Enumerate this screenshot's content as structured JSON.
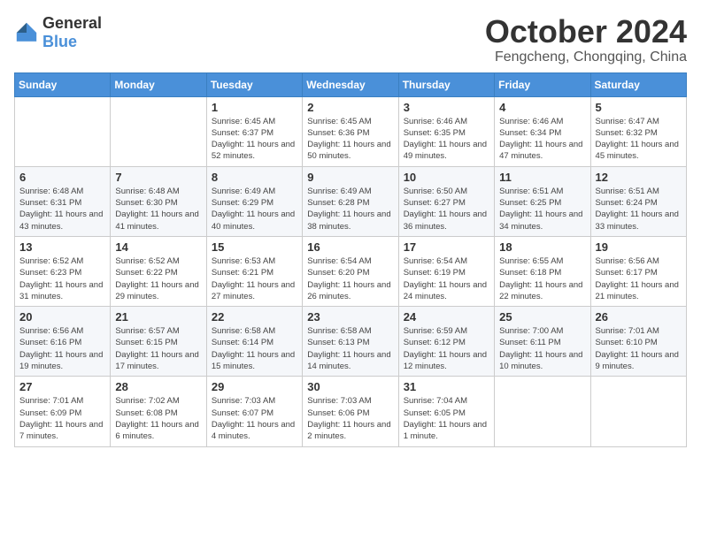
{
  "logo": {
    "text_general": "General",
    "text_blue": "Blue"
  },
  "header": {
    "month": "October 2024",
    "location": "Fengcheng, Chongqing, China"
  },
  "weekdays": [
    "Sunday",
    "Monday",
    "Tuesday",
    "Wednesday",
    "Thursday",
    "Friday",
    "Saturday"
  ],
  "weeks": [
    [
      {
        "day": "",
        "info": ""
      },
      {
        "day": "",
        "info": ""
      },
      {
        "day": "1",
        "info": "Sunrise: 6:45 AM\nSunset: 6:37 PM\nDaylight: 11 hours and 52 minutes."
      },
      {
        "day": "2",
        "info": "Sunrise: 6:45 AM\nSunset: 6:36 PM\nDaylight: 11 hours and 50 minutes."
      },
      {
        "day": "3",
        "info": "Sunrise: 6:46 AM\nSunset: 6:35 PM\nDaylight: 11 hours and 49 minutes."
      },
      {
        "day": "4",
        "info": "Sunrise: 6:46 AM\nSunset: 6:34 PM\nDaylight: 11 hours and 47 minutes."
      },
      {
        "day": "5",
        "info": "Sunrise: 6:47 AM\nSunset: 6:32 PM\nDaylight: 11 hours and 45 minutes."
      }
    ],
    [
      {
        "day": "6",
        "info": "Sunrise: 6:48 AM\nSunset: 6:31 PM\nDaylight: 11 hours and 43 minutes."
      },
      {
        "day": "7",
        "info": "Sunrise: 6:48 AM\nSunset: 6:30 PM\nDaylight: 11 hours and 41 minutes."
      },
      {
        "day": "8",
        "info": "Sunrise: 6:49 AM\nSunset: 6:29 PM\nDaylight: 11 hours and 40 minutes."
      },
      {
        "day": "9",
        "info": "Sunrise: 6:49 AM\nSunset: 6:28 PM\nDaylight: 11 hours and 38 minutes."
      },
      {
        "day": "10",
        "info": "Sunrise: 6:50 AM\nSunset: 6:27 PM\nDaylight: 11 hours and 36 minutes."
      },
      {
        "day": "11",
        "info": "Sunrise: 6:51 AM\nSunset: 6:25 PM\nDaylight: 11 hours and 34 minutes."
      },
      {
        "day": "12",
        "info": "Sunrise: 6:51 AM\nSunset: 6:24 PM\nDaylight: 11 hours and 33 minutes."
      }
    ],
    [
      {
        "day": "13",
        "info": "Sunrise: 6:52 AM\nSunset: 6:23 PM\nDaylight: 11 hours and 31 minutes."
      },
      {
        "day": "14",
        "info": "Sunrise: 6:52 AM\nSunset: 6:22 PM\nDaylight: 11 hours and 29 minutes."
      },
      {
        "day": "15",
        "info": "Sunrise: 6:53 AM\nSunset: 6:21 PM\nDaylight: 11 hours and 27 minutes."
      },
      {
        "day": "16",
        "info": "Sunrise: 6:54 AM\nSunset: 6:20 PM\nDaylight: 11 hours and 26 minutes."
      },
      {
        "day": "17",
        "info": "Sunrise: 6:54 AM\nSunset: 6:19 PM\nDaylight: 11 hours and 24 minutes."
      },
      {
        "day": "18",
        "info": "Sunrise: 6:55 AM\nSunset: 6:18 PM\nDaylight: 11 hours and 22 minutes."
      },
      {
        "day": "19",
        "info": "Sunrise: 6:56 AM\nSunset: 6:17 PM\nDaylight: 11 hours and 21 minutes."
      }
    ],
    [
      {
        "day": "20",
        "info": "Sunrise: 6:56 AM\nSunset: 6:16 PM\nDaylight: 11 hours and 19 minutes."
      },
      {
        "day": "21",
        "info": "Sunrise: 6:57 AM\nSunset: 6:15 PM\nDaylight: 11 hours and 17 minutes."
      },
      {
        "day": "22",
        "info": "Sunrise: 6:58 AM\nSunset: 6:14 PM\nDaylight: 11 hours and 15 minutes."
      },
      {
        "day": "23",
        "info": "Sunrise: 6:58 AM\nSunset: 6:13 PM\nDaylight: 11 hours and 14 minutes."
      },
      {
        "day": "24",
        "info": "Sunrise: 6:59 AM\nSunset: 6:12 PM\nDaylight: 11 hours and 12 minutes."
      },
      {
        "day": "25",
        "info": "Sunrise: 7:00 AM\nSunset: 6:11 PM\nDaylight: 11 hours and 10 minutes."
      },
      {
        "day": "26",
        "info": "Sunrise: 7:01 AM\nSunset: 6:10 PM\nDaylight: 11 hours and 9 minutes."
      }
    ],
    [
      {
        "day": "27",
        "info": "Sunrise: 7:01 AM\nSunset: 6:09 PM\nDaylight: 11 hours and 7 minutes."
      },
      {
        "day": "28",
        "info": "Sunrise: 7:02 AM\nSunset: 6:08 PM\nDaylight: 11 hours and 6 minutes."
      },
      {
        "day": "29",
        "info": "Sunrise: 7:03 AM\nSunset: 6:07 PM\nDaylight: 11 hours and 4 minutes."
      },
      {
        "day": "30",
        "info": "Sunrise: 7:03 AM\nSunset: 6:06 PM\nDaylight: 11 hours and 2 minutes."
      },
      {
        "day": "31",
        "info": "Sunrise: 7:04 AM\nSunset: 6:05 PM\nDaylight: 11 hours and 1 minute."
      },
      {
        "day": "",
        "info": ""
      },
      {
        "day": "",
        "info": ""
      }
    ]
  ]
}
